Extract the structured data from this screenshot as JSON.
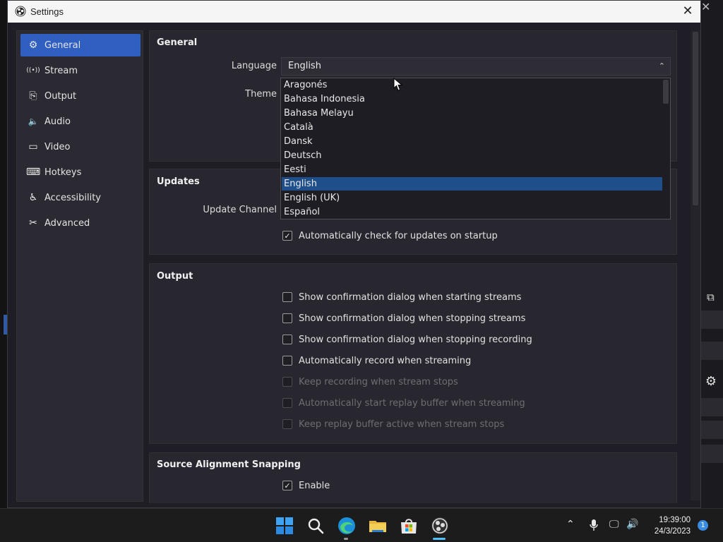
{
  "window": {
    "title": "Settings",
    "close_glyph": "✕"
  },
  "sidebar": {
    "items": [
      {
        "label": "General",
        "icon": "gear-icon",
        "glyph": "⚙",
        "active": true
      },
      {
        "label": "Stream",
        "icon": "broadcast-icon",
        "glyph": "((•))"
      },
      {
        "label": "Output",
        "icon": "output-icon",
        "glyph": "⎘"
      },
      {
        "label": "Audio",
        "icon": "speaker-icon",
        "glyph": "🔈"
      },
      {
        "label": "Video",
        "icon": "monitor-icon",
        "glyph": "▭"
      },
      {
        "label": "Hotkeys",
        "icon": "keyboard-icon",
        "glyph": "⌨"
      },
      {
        "label": "Accessibility",
        "icon": "accessibility-icon",
        "glyph": "♿"
      },
      {
        "label": "Advanced",
        "icon": "tools-icon",
        "glyph": "✂"
      }
    ]
  },
  "general": {
    "title": "General",
    "language_label": "Language",
    "language_value": "English",
    "theme_label": "Theme"
  },
  "updates": {
    "title": "Updates",
    "channel_label": "Update Channel",
    "auto_check": {
      "label": "Automatically check for updates on startup",
      "checked": true
    }
  },
  "output": {
    "title": "Output",
    "options": [
      {
        "label": "Show confirmation dialog when starting streams",
        "checked": false,
        "enabled": true
      },
      {
        "label": "Show confirmation dialog when stopping streams",
        "checked": false,
        "enabled": true
      },
      {
        "label": "Show confirmation dialog when stopping recording",
        "checked": false,
        "enabled": true
      },
      {
        "label": "Automatically record when streaming",
        "checked": false,
        "enabled": true
      },
      {
        "label": "Keep recording when stream stops",
        "checked": false,
        "enabled": false
      },
      {
        "label": "Automatically start replay buffer when streaming",
        "checked": false,
        "enabled": false
      },
      {
        "label": "Keep replay buffer active when stream stops",
        "checked": false,
        "enabled": false
      }
    ]
  },
  "snapping": {
    "title": "Source Alignment Snapping",
    "enable": {
      "label": "Enable",
      "checked": true
    }
  },
  "language_dropdown": {
    "options": [
      "Aragonés",
      "Bahasa Indonesia",
      "Bahasa Melayu",
      "Català",
      "Dansk",
      "Deutsch",
      "Eesti",
      "English",
      "English (UK)",
      "Español"
    ],
    "selected": "English"
  },
  "taskbar": {
    "time": "19:39:00",
    "date": "24/3/2023",
    "notification_count": "1"
  },
  "colors": {
    "accent": "#2f5fc0",
    "selection": "#1f4f8a"
  }
}
